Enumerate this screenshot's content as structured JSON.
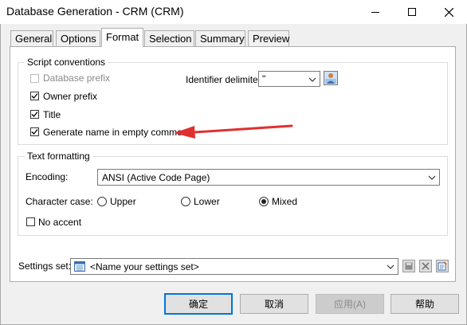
{
  "window": {
    "title": "Database Generation - CRM (CRM)"
  },
  "tabs": [
    {
      "label": "General"
    },
    {
      "label": "Options"
    },
    {
      "label": "Format"
    },
    {
      "label": "Selection"
    },
    {
      "label": "Summary"
    },
    {
      "label": "Preview"
    }
  ],
  "active_tab": "Format",
  "script_conventions": {
    "legend": "Script conventions",
    "database_prefix": {
      "label": "Database prefix",
      "checked": false,
      "enabled": false
    },
    "owner_prefix": {
      "label": "Owner prefix",
      "checked": true
    },
    "title": {
      "label": "Title",
      "checked": true
    },
    "generate_name": {
      "label": "Generate name in empty comment",
      "checked": true
    },
    "identifier_delimiter": {
      "label": "Identifier delimiter:",
      "value": "\""
    }
  },
  "text_formatting": {
    "legend": "Text formatting",
    "encoding_label": "Encoding:",
    "encoding_value": "ANSI (Active Code Page)",
    "character_case_label": "Character case:",
    "case_options": [
      {
        "label": "Upper",
        "selected": false
      },
      {
        "label": "Lower",
        "selected": false
      },
      {
        "label": "Mixed",
        "selected": true
      }
    ],
    "no_accent": {
      "label": "No accent",
      "checked": false
    }
  },
  "settings_set": {
    "label": "Settings set:",
    "value": "<Name your settings set>"
  },
  "buttons": {
    "ok": "确定",
    "cancel": "取消",
    "apply": "应用(A)",
    "help": "帮助"
  },
  "colors": {
    "annotation_arrow": "#e03030",
    "default_button_border": "#0078d7"
  }
}
